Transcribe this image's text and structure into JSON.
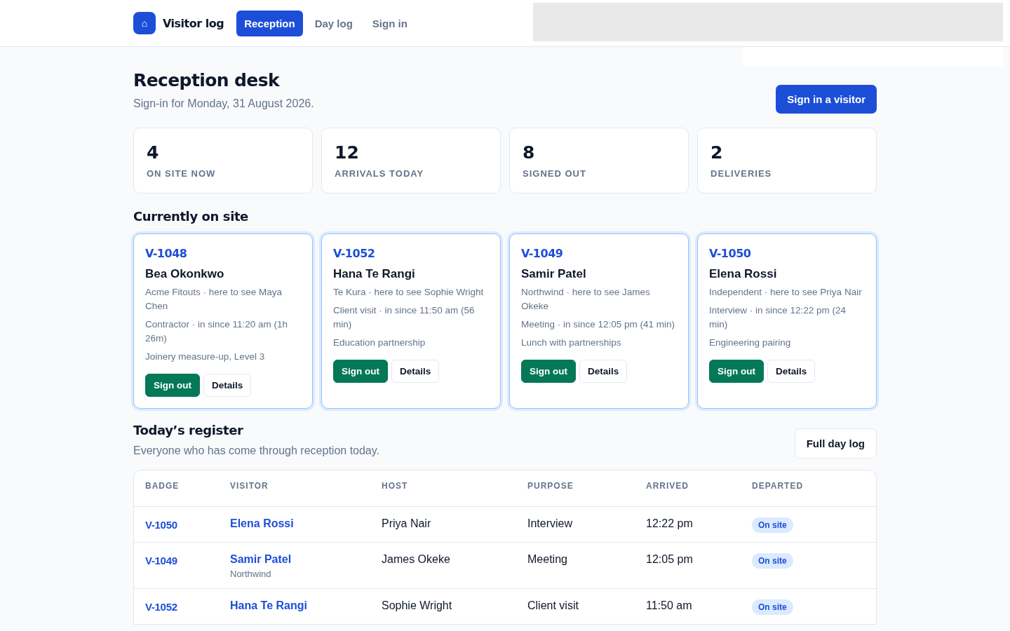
{
  "nav": {
    "logo_icon": "⌂",
    "brand": "Visitor log",
    "tabs": [
      {
        "label": "Reception",
        "selected": true
      },
      {
        "label": "Day log",
        "selected": false
      },
      {
        "label": "Sign in",
        "selected": false
      }
    ]
  },
  "header": {
    "title": "Reception desk",
    "subtitle": "Sign-in for Monday, 31 August 2026.",
    "action": "Sign in a visitor"
  },
  "stats": [
    {
      "value": "4",
      "label": "ON SITE NOW"
    },
    {
      "value": "12",
      "label": "ARRIVALS TODAY"
    },
    {
      "value": "8",
      "label": "SIGNED OUT"
    },
    {
      "value": "2",
      "label": "DELIVERIES"
    }
  ],
  "on_site": {
    "title": "Currently on site",
    "visitors": [
      {
        "badge": "V-1048",
        "name": "Bea Okonkwo",
        "company_host": "Acme Fitouts · here to see Maya Chen",
        "visit": "Contractor · in since 11:20 am (1h 26m)",
        "note": "Joinery measure-up, Level 3",
        "actions": [
          "Sign out",
          "Details"
        ]
      },
      {
        "badge": "V-1052",
        "name": "Hana Te Rangi",
        "company_host": "Te Kura · here to see Sophie Wright",
        "visit": "Client visit · in since 11:50 am (56 min)",
        "note": "Education partnership",
        "actions": [
          "Sign out",
          "Details"
        ]
      },
      {
        "badge": "V-1049",
        "name": "Samir Patel",
        "company_host": "Northwind · here to see James Okeke",
        "visit": "Meeting · in since 12:05 pm (41 min)",
        "note": "Lunch with partnerships",
        "actions": [
          "Sign out",
          "Details"
        ]
      },
      {
        "badge": "V-1050",
        "name": "Elena Rossi",
        "company_host": "Independent · here to see Priya Nair",
        "visit": "Interview · in since 12:22 pm (24 min)",
        "note": "Engineering pairing",
        "actions": [
          "Sign out",
          "Details"
        ]
      }
    ]
  },
  "register": {
    "title": "Today’s register",
    "subtitle": "Everyone who has come through reception today.",
    "action": "Full day log",
    "columns": [
      "BADGE",
      "VISITOR",
      "HOST",
      "PURPOSE",
      "ARRIVED",
      "DEPARTED"
    ],
    "rows": [
      {
        "badge": "V-1050",
        "visitor": "Elena Rossi",
        "host": "Priya Nair",
        "purpose": "Interview",
        "arrived": "12:22 pm",
        "departed": "On site"
      },
      {
        "badge": "V-1049",
        "visitor": "Samir Patel",
        "company": "Northwind",
        "host": "James Okeke",
        "purpose": "Meeting",
        "arrived": "12:05 pm",
        "departed": "On site"
      },
      {
        "badge": "V-1052",
        "visitor": "Hana Te Rangi",
        "host": "Sophie Wright",
        "purpose": "Client visit",
        "arrived": "11:50 am",
        "departed": "On site"
      }
    ]
  }
}
